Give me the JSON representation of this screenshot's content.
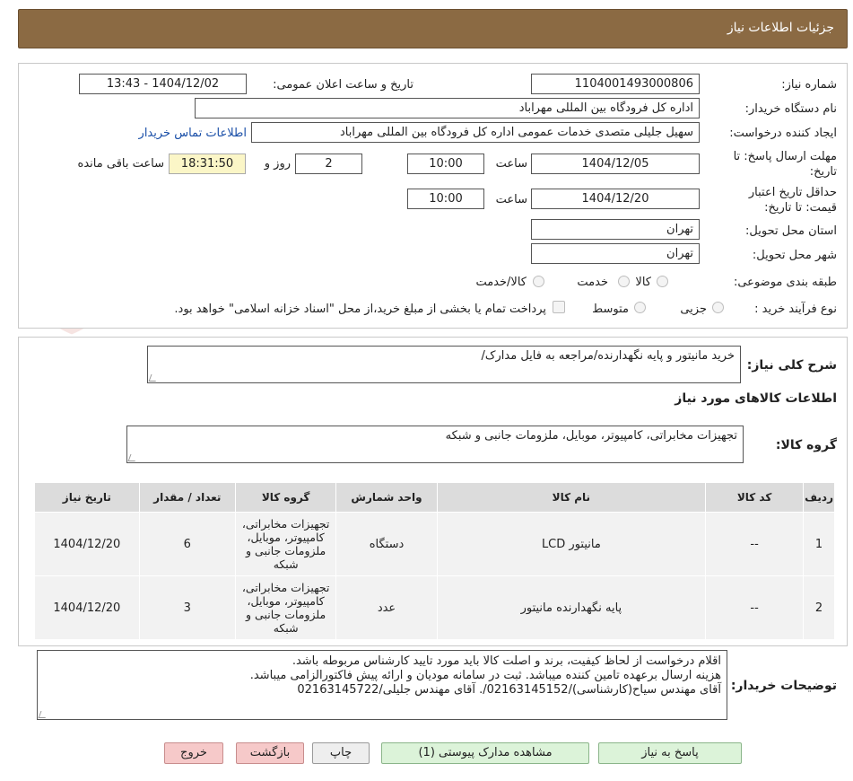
{
  "header": {
    "title": "جزئیات اطلاعات نیاز"
  },
  "watermark": {
    "text": "AriaTender.neT"
  },
  "info": {
    "need_number_label": "شماره نیاز:",
    "need_number": "1104001493000806",
    "announce_label": "تاریخ و ساعت اعلان عمومی:",
    "announce_value": "1404/12/02 - 13:43",
    "buyer_org_label": "نام دستگاه خریدار:",
    "buyer_org": "اداره کل فرودگاه بین المللی مهراباد",
    "requester_label": "ایجاد کننده درخواست:",
    "requester": "سهیل جلیلی متصدی خدمات عمومی اداره کل فرودگاه بین المللی مهراباد",
    "contact_link": "اطلاعات تماس خریدار",
    "reply_deadline_label_1": "مهلت ارسال پاسخ: تا",
    "reply_deadline_label_2": "تاریخ:",
    "reply_date": "1404/12/05",
    "time_label": "ساعت",
    "reply_time": "10:00",
    "days_value": "2",
    "days_label": "روز و",
    "remaining_time": "18:31:50",
    "remaining_label": "ساعت باقی مانده",
    "validity_label_1": "حداقل تاریخ اعتبار",
    "validity_label_2": "قیمت: تا تاریخ:",
    "validity_date": "1404/12/20",
    "validity_time": "10:00",
    "province_label": "استان محل تحویل:",
    "province": "تهران",
    "city_label": "شهر محل تحویل:",
    "city": "تهران",
    "category_label": "طبقه بندی موضوعی:",
    "category_options": [
      "کالا",
      "خدمت",
      "کالا/خدمت"
    ],
    "process_label": "نوع فرآیند خرید :",
    "process_options": [
      "جزیی",
      "متوسط"
    ],
    "payment_note": "پرداخت تمام یا بخشی از مبلغ خرید،از محل \"اسناد خزانه اسلامی\" خواهد بود."
  },
  "summary": {
    "label": "شرح کلی نیاز:",
    "value": "خرید مانیتور و پایه نگهدارنده/مراجعه به فایل مدارک/"
  },
  "goods_section_title": "اطلاعات کالاهای مورد نیاز",
  "goods_group": {
    "label": "گروه کالا:",
    "value": "تجهیزات مخابراتی، کامپیوتر، موبایل، ملزومات جانبی و شبکه"
  },
  "table": {
    "headers": [
      "ردیف",
      "کد کالا",
      "نام کالا",
      "واحد شمارش",
      "گروه کالا",
      "تعداد / مقدار",
      "تاریخ نیاز"
    ],
    "rows": [
      [
        "1",
        "--",
        "مانیتور LCD",
        "دستگاه",
        "تجهیزات مخابراتی، کامپیوتر، موبایل، ملزومات جانبی و شبکه",
        "6",
        "1404/12/20"
      ],
      [
        "2",
        "--",
        "پایه نگهدارنده مانیتور",
        "عدد",
        "تجهیزات مخابراتی، کامپیوتر، موبایل، ملزومات جانبی و شبکه",
        "3",
        "1404/12/20"
      ]
    ]
  },
  "buyer_notes": {
    "label": "توضیحات خریدار:",
    "lines": [
      "اقلام درخواست از لحاظ کیفیت، برند و اصلت کالا باید مورد تایید کارشناس مربوطه باشد.",
      "هزینه ارسال برعهده تامین کننده میباشد. ثبت در سامانه مودیان و ارائه پیش فاکتورالزامی میباشد.",
      "آقای مهندس سیاح(کارشناسی)/02163145152/. آقای مهندس جلیلی/02163145722"
    ]
  },
  "buttons": {
    "reply": "پاسخ به نیاز",
    "attachments": "مشاهده مدارک پیوستی (1)",
    "print": "چاپ",
    "back": "بازگشت",
    "exit": "خروج"
  }
}
